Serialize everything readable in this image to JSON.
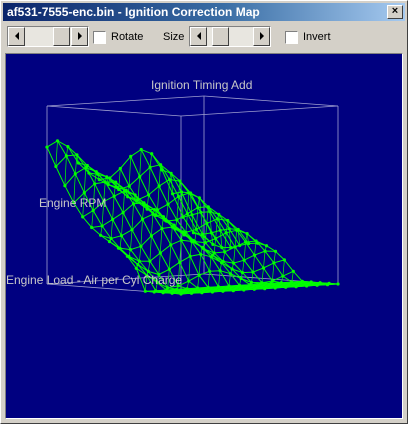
{
  "window": {
    "title": "af531-7555-enc.bin - Ignition Correction Map",
    "close_glyph": "×"
  },
  "toolbar": {
    "rotate_label": "Rotate",
    "rotate_checked": false,
    "size_label": "Size",
    "invert_label": "Invert",
    "invert_checked": false
  },
  "plot": {
    "z_axis_label": "Ignition Timing Add",
    "y_axis_label": "Engine RPM",
    "x_axis_label": "Engine Load - Air per Cyl Charge",
    "background_color": "#000080",
    "box_color": "#a0a0d0",
    "mesh_color": "#00ff00"
  }
}
